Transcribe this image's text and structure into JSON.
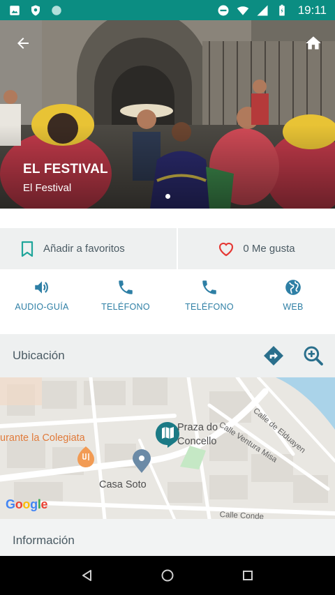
{
  "status_bar": {
    "time": "19:11",
    "left_icons": [
      "image-icon",
      "shield-icon",
      "circle-icon"
    ],
    "right_icons": [
      "do-not-disturb-icon",
      "wifi-icon",
      "signal-icon",
      "battery-icon"
    ]
  },
  "hero": {
    "title": "EL FESTIVAL",
    "subtitle": "El Festival",
    "slides": 1,
    "active_slide": 1
  },
  "favorites": {
    "label": "Añadir a favoritos"
  },
  "likes": {
    "label": "0 Me gusta"
  },
  "actions": [
    {
      "label": "AUDIO-GUÍA",
      "icon": "volume-icon"
    },
    {
      "label": "TELÉFONO",
      "icon": "phone-icon"
    },
    {
      "label": "TELÉFONO",
      "icon": "phone-icon"
    },
    {
      "label": "WEB",
      "icon": "globe-icon"
    }
  ],
  "location": {
    "title": "Ubicación"
  },
  "map": {
    "place_label_1": "Praza do",
    "place_label_2": "Concello",
    "restaurant_label": "urante la Colegiata",
    "poi_label": "Casa Soto",
    "street_1": "Calle de Elduayen",
    "street_2": "Calle Ventura Misa",
    "street_3": "Calle Conde",
    "logo": "Google"
  },
  "info": {
    "title": "Información"
  },
  "colors": {
    "status_bar": "#0b8d82",
    "accent": "#2e7fa5",
    "teal_marker": "#1b7a85",
    "heart": "#e53935"
  }
}
